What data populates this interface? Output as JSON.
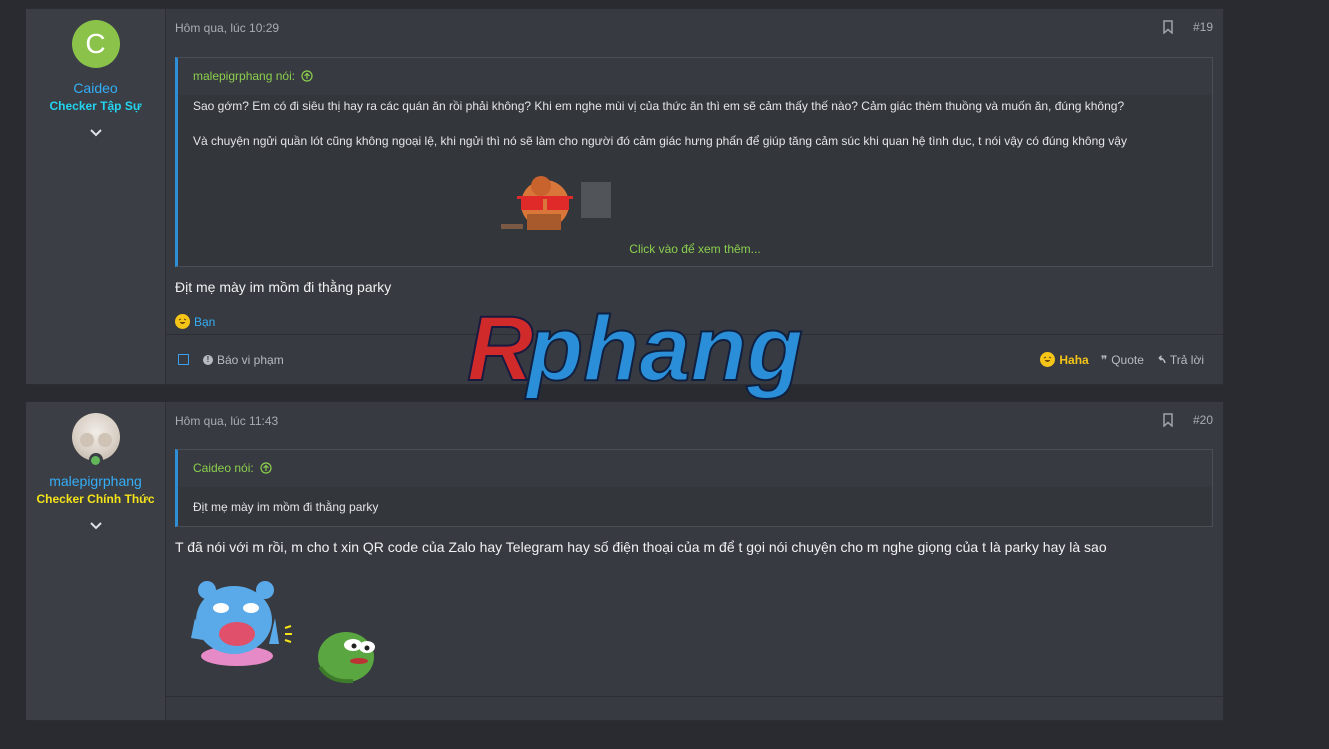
{
  "posts": [
    {
      "user": {
        "initial": "C",
        "name": "Caideo",
        "title": "Checker Tập Sự"
      },
      "time": "Hôm qua, lúc 10:29",
      "number": "#19",
      "quote": {
        "author_line": "malepigrphang nói:",
        "lines": [
          "Sao gớm? Em có đi siêu thị hay ra các quán ăn rồi phải không? Khi em nghe mùi vị của thức ăn thì em sẽ cảm thấy thế nào? Cảm giác thèm thuồng và muốn ăn, đúng không?",
          "Và chuyện ngửi quần lót cũng không ngoại lệ, khi ngửi thì nó sẽ làm cho người đó cảm giác hưng phấn để giúp tăng cảm súc khi quan hệ tình dục, t nói vậy có đúng không vậy"
        ],
        "expand": "Click vào để xem thêm..."
      },
      "body": "Địt mẹ mày im mồm đi thằng parky",
      "reaction_user": "Bạn",
      "footer": {
        "report": "Báo vi phạm",
        "haha": "Haha",
        "quote": "Quote",
        "reply": "Trả lời"
      }
    },
    {
      "user": {
        "name": "malepigrphang",
        "title": "Checker Chính Thức"
      },
      "time": "Hôm qua, lúc 11:43",
      "number": "#20",
      "quote": {
        "author_line": "Caideo nói:",
        "lines": [
          "Địt mẹ mày im mồm đi thằng parky"
        ]
      },
      "body": "T đã nói với m rồi, m cho t xin QR code của Zalo hay Telegram hay số điện thoại của m để t gọi nói chuyện cho m nghe giọng của t là parky hay là sao"
    }
  ],
  "watermark": "Rphang",
  "colors": {
    "link": "#34aef7",
    "quote_author": "#8ccf4e",
    "title_cyan": "#22d4f0",
    "title_yellow": "#f4e31a",
    "haha": "#f5c518"
  }
}
